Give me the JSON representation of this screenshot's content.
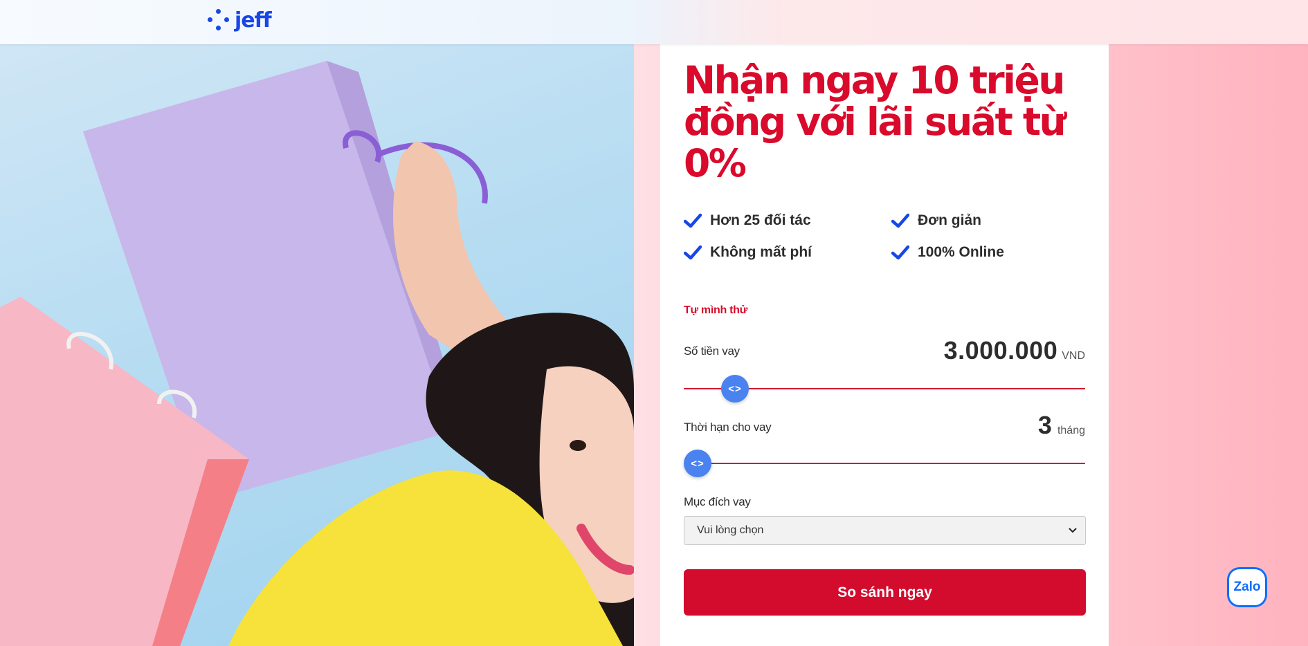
{
  "brand": {
    "name": "jeff",
    "color": "#1847e8"
  },
  "hero": {
    "image": "woman-with-shopping-bags-photo"
  },
  "headline": "Nhận ngay 10 triệu đồng với lãi suất từ 0%",
  "features": [
    {
      "label": "Hơn 25 đối tác",
      "icon": "check-icon"
    },
    {
      "label": "Đơn giản",
      "icon": "check-icon"
    },
    {
      "label": "Không mất phí",
      "icon": "check-icon"
    },
    {
      "label": "100% Online",
      "icon": "check-icon"
    }
  ],
  "calculator": {
    "title": "Tự mình thử",
    "amount": {
      "label": "Số tiền vay",
      "value": "3.000.000",
      "unit": "VND",
      "level": 0.1
    },
    "term": {
      "label": "Thời hạn cho vay",
      "value": "3",
      "unit": "tháng",
      "level": 0.0
    },
    "purpose": {
      "label": "Mục đích vay",
      "selected": "Vui lòng chọn"
    },
    "submit_label": "So sánh ngay",
    "thumb_symbol": "<>"
  },
  "chat": {
    "label": "Zalo"
  },
  "colors": {
    "accent": "#d90a2b",
    "slider_thumb": "#4a82f0",
    "check": "#1847e8"
  }
}
